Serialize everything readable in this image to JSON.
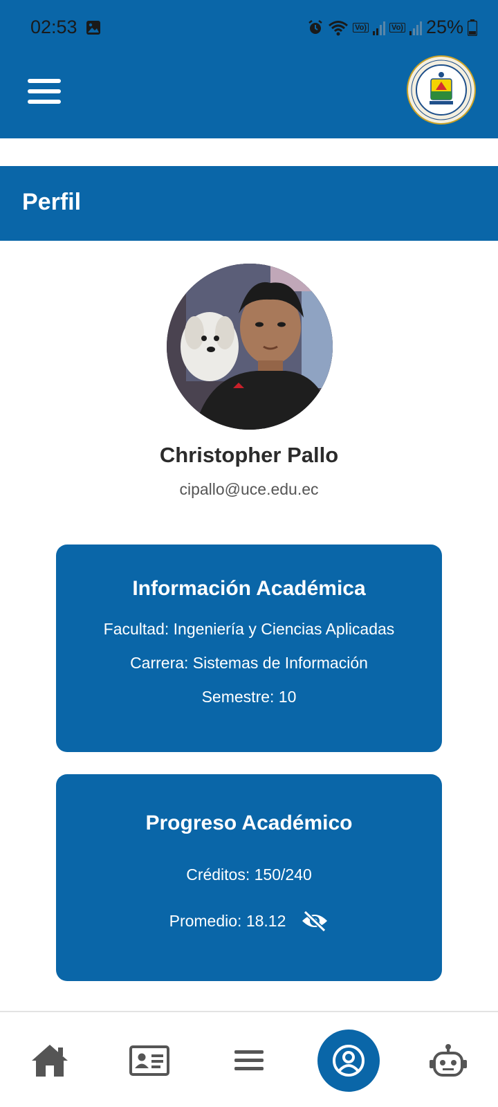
{
  "status_bar": {
    "time": "02:53",
    "battery": "25%",
    "icons": [
      "gallery-icon",
      "alarm-icon",
      "wifi-icon",
      "volte-signal-icon",
      "volte-signal-icon",
      "battery-icon"
    ],
    "sim1_label": "Vo)",
    "sim2_label": "Vo)"
  },
  "app_bar": {
    "menu_icon": "menu-icon",
    "logo": "university-seal-logo"
  },
  "page": {
    "title": "Perfil"
  },
  "profile": {
    "name": "Christopher Pallo",
    "email": "cipallo@uce.edu.ec"
  },
  "academic_info": {
    "title": "Información Académica",
    "faculty": "Facultad: Ingeniería y Ciencias Aplicadas",
    "career": "Carrera: Sistemas de Información",
    "semester": "Semestre: 10"
  },
  "academic_progress": {
    "title": "Progreso Académico",
    "credits": "Créditos: 150/240",
    "average": "Promedio: 18.12",
    "toggle_icon": "eye-off-icon"
  },
  "bottom_nav": {
    "items": [
      "home-icon",
      "id-card-icon",
      "menu-icon",
      "profile-icon",
      "robot-icon"
    ],
    "active": "profile-icon"
  },
  "colors": {
    "primary": "#0a66a8",
    "text_dark": "#2b2b2b",
    "nav_icon": "#555555"
  }
}
